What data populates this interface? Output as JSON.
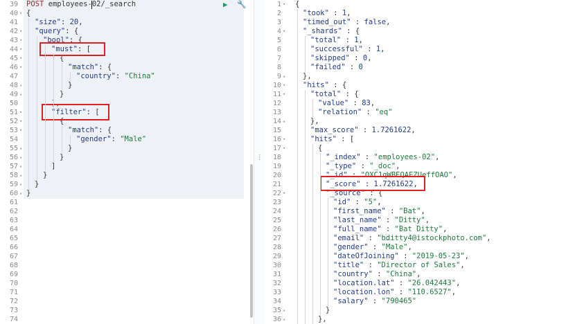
{
  "left_editor": {
    "method": "POST",
    "path_before_cursor": "employees-02",
    "path_after_cursor": "/_search",
    "lines": [
      {
        "n": "39",
        "fold": "",
        "indent": 0,
        "parts": []
      },
      {
        "n": "40",
        "fold": "▾",
        "indent": 0,
        "parts": [
          [
            "pl",
            "{"
          ]
        ]
      },
      {
        "n": "41",
        "fold": "",
        "indent": 1,
        "parts": [
          [
            "key",
            "\"size\""
          ],
          [
            "pl",
            ": "
          ],
          [
            "num",
            "20"
          ],
          [
            "pl",
            ","
          ]
        ]
      },
      {
        "n": "42",
        "fold": "▾",
        "indent": 1,
        "parts": [
          [
            "key",
            "\"query\""
          ],
          [
            "pl",
            ": {"
          ]
        ]
      },
      {
        "n": "43",
        "fold": "▾",
        "indent": 2,
        "parts": [
          [
            "key",
            "\"bool\""
          ],
          [
            "pl",
            ": {"
          ]
        ]
      },
      {
        "n": "44",
        "fold": "▾",
        "indent": 3,
        "parts": [
          [
            "key",
            "\"must\""
          ],
          [
            "pl",
            ": ["
          ]
        ]
      },
      {
        "n": "45",
        "fold": "▾",
        "indent": 4,
        "parts": [
          [
            "pl",
            "{"
          ]
        ]
      },
      {
        "n": "46",
        "fold": "▾",
        "indent": 5,
        "parts": [
          [
            "key",
            "\"match\""
          ],
          [
            "pl",
            ": {"
          ]
        ]
      },
      {
        "n": "47",
        "fold": "",
        "indent": 6,
        "parts": [
          [
            "key",
            "\"country\""
          ],
          [
            "pl",
            ": "
          ],
          [
            "str",
            "\"China\""
          ]
        ]
      },
      {
        "n": "48",
        "fold": "▴",
        "indent": 5,
        "parts": [
          [
            "pl",
            "}"
          ]
        ]
      },
      {
        "n": "49",
        "fold": "▴",
        "indent": 4,
        "parts": [
          [
            "pl",
            "}"
          ]
        ]
      },
      {
        "n": "50",
        "fold": "",
        "indent": 3,
        "parts": [
          [
            "pl",
            "],"
          ]
        ]
      },
      {
        "n": "51",
        "fold": "▾",
        "indent": 3,
        "parts": [
          [
            "key",
            "\"filter\""
          ],
          [
            "pl",
            ": ["
          ]
        ]
      },
      {
        "n": "52",
        "fold": "▾",
        "indent": 4,
        "parts": [
          [
            "pl",
            "{"
          ]
        ]
      },
      {
        "n": "53",
        "fold": "▾",
        "indent": 5,
        "parts": [
          [
            "key",
            "\"match\""
          ],
          [
            "pl",
            ": {"
          ]
        ]
      },
      {
        "n": "54",
        "fold": "",
        "indent": 6,
        "parts": [
          [
            "key",
            "\"gender\""
          ],
          [
            "pl",
            ": "
          ],
          [
            "str",
            "\"Male\""
          ]
        ]
      },
      {
        "n": "55",
        "fold": "▴",
        "indent": 5,
        "parts": [
          [
            "pl",
            "}"
          ]
        ]
      },
      {
        "n": "56",
        "fold": "▴",
        "indent": 4,
        "parts": [
          [
            "pl",
            "}"
          ]
        ]
      },
      {
        "n": "57",
        "fold": "▴",
        "indent": 3,
        "parts": [
          [
            "pl",
            "]"
          ]
        ]
      },
      {
        "n": "58",
        "fold": "▴",
        "indent": 2,
        "parts": [
          [
            "pl",
            "}"
          ]
        ]
      },
      {
        "n": "59",
        "fold": "▴",
        "indent": 1,
        "parts": [
          [
            "pl",
            "}"
          ]
        ]
      },
      {
        "n": "60",
        "fold": "▴",
        "indent": 0,
        "parts": [
          [
            "pl",
            "}"
          ]
        ]
      },
      {
        "n": "61",
        "fold": "",
        "indent": 0,
        "parts": []
      },
      {
        "n": "62",
        "fold": "",
        "indent": 0,
        "parts": []
      },
      {
        "n": "63",
        "fold": "",
        "indent": 0,
        "parts": []
      },
      {
        "n": "64",
        "fold": "",
        "indent": 0,
        "parts": []
      },
      {
        "n": "65",
        "fold": "",
        "indent": 0,
        "parts": []
      },
      {
        "n": "66",
        "fold": "",
        "indent": 0,
        "parts": []
      },
      {
        "n": "67",
        "fold": "",
        "indent": 0,
        "parts": []
      },
      {
        "n": "68",
        "fold": "",
        "indent": 0,
        "parts": []
      },
      {
        "n": "69",
        "fold": "",
        "indent": 0,
        "parts": []
      },
      {
        "n": "70",
        "fold": "",
        "indent": 0,
        "parts": []
      },
      {
        "n": "71",
        "fold": "",
        "indent": 0,
        "parts": []
      },
      {
        "n": "72",
        "fold": "",
        "indent": 0,
        "parts": []
      },
      {
        "n": "73",
        "fold": "",
        "indent": 0,
        "parts": []
      },
      {
        "n": "74",
        "fold": "",
        "indent": 0,
        "parts": []
      }
    ]
  },
  "right_output": {
    "lines": [
      {
        "n": "1",
        "fold": "▾",
        "indent": 0,
        "parts": [
          [
            "pl",
            "{"
          ]
        ]
      },
      {
        "n": "2",
        "fold": "",
        "indent": 1,
        "parts": [
          [
            "key",
            "\"took\""
          ],
          [
            "pl",
            " : "
          ],
          [
            "num",
            "1"
          ],
          [
            "pl",
            ","
          ]
        ]
      },
      {
        "n": "3",
        "fold": "",
        "indent": 1,
        "parts": [
          [
            "key",
            "\"timed_out\""
          ],
          [
            "pl",
            " : "
          ],
          [
            "num",
            "false"
          ],
          [
            "pl",
            ","
          ]
        ]
      },
      {
        "n": "4",
        "fold": "▾",
        "indent": 1,
        "parts": [
          [
            "key",
            "\"_shards\""
          ],
          [
            "pl",
            " : {"
          ]
        ]
      },
      {
        "n": "5",
        "fold": "",
        "indent": 2,
        "parts": [
          [
            "key",
            "\"total\""
          ],
          [
            "pl",
            " : "
          ],
          [
            "num",
            "1"
          ],
          [
            "pl",
            ","
          ]
        ]
      },
      {
        "n": "6",
        "fold": "",
        "indent": 2,
        "parts": [
          [
            "key",
            "\"successful\""
          ],
          [
            "pl",
            " : "
          ],
          [
            "num",
            "1"
          ],
          [
            "pl",
            ","
          ]
        ]
      },
      {
        "n": "7",
        "fold": "",
        "indent": 2,
        "parts": [
          [
            "key",
            "\"skipped\""
          ],
          [
            "pl",
            " : "
          ],
          [
            "num",
            "0"
          ],
          [
            "pl",
            ","
          ]
        ]
      },
      {
        "n": "8",
        "fold": "",
        "indent": 2,
        "parts": [
          [
            "key",
            "\"failed\""
          ],
          [
            "pl",
            " : "
          ],
          [
            "num",
            "0"
          ]
        ]
      },
      {
        "n": "9",
        "fold": "▴",
        "indent": 1,
        "parts": [
          [
            "pl",
            "},"
          ]
        ]
      },
      {
        "n": "10",
        "fold": "▾",
        "indent": 1,
        "parts": [
          [
            "key",
            "\"hits\""
          ],
          [
            "pl",
            " : {"
          ]
        ]
      },
      {
        "n": "11",
        "fold": "▾",
        "indent": 2,
        "parts": [
          [
            "key",
            "\"total\""
          ],
          [
            "pl",
            " : {"
          ]
        ]
      },
      {
        "n": "12",
        "fold": "",
        "indent": 3,
        "parts": [
          [
            "key",
            "\"value\""
          ],
          [
            "pl",
            " : "
          ],
          [
            "num",
            "83"
          ],
          [
            "pl",
            ","
          ]
        ]
      },
      {
        "n": "13",
        "fold": "",
        "indent": 3,
        "parts": [
          [
            "key",
            "\"relation\""
          ],
          [
            "pl",
            " : "
          ],
          [
            "str",
            "\"eq\""
          ]
        ]
      },
      {
        "n": "14",
        "fold": "▴",
        "indent": 2,
        "parts": [
          [
            "pl",
            "},"
          ]
        ]
      },
      {
        "n": "15",
        "fold": "",
        "indent": 2,
        "parts": [
          [
            "key",
            "\"max_score\""
          ],
          [
            "pl",
            " : "
          ],
          [
            "num",
            "1.7261622"
          ],
          [
            "pl",
            ","
          ]
        ]
      },
      {
        "n": "16",
        "fold": "▾",
        "indent": 2,
        "parts": [
          [
            "key",
            "\"hits\""
          ],
          [
            "pl",
            " : ["
          ]
        ]
      },
      {
        "n": "17",
        "fold": "▾",
        "indent": 3,
        "parts": [
          [
            "pl",
            "{"
          ]
        ]
      },
      {
        "n": "18",
        "fold": "",
        "indent": 4,
        "parts": [
          [
            "key",
            "\"_index\""
          ],
          [
            "pl",
            " : "
          ],
          [
            "str",
            "\"employees-02\""
          ],
          [
            "pl",
            ","
          ]
        ]
      },
      {
        "n": "19",
        "fold": "",
        "indent": 4,
        "parts": [
          [
            "key",
            "\"_type\""
          ],
          [
            "pl",
            " : "
          ],
          [
            "str",
            "\"_doc\""
          ],
          [
            "pl",
            ","
          ]
        ]
      },
      {
        "n": "20",
        "fold": "",
        "indent": 4,
        "parts": [
          [
            "key",
            "\"_id\""
          ],
          [
            "pl",
            " : "
          ],
          [
            "str",
            "\"OXC1qWBEQAEZUeffOAO\""
          ],
          [
            "pl",
            ","
          ]
        ]
      },
      {
        "n": "21",
        "fold": "",
        "indent": 4,
        "parts": [
          [
            "key",
            "\"_score\""
          ],
          [
            "pl",
            " : "
          ],
          [
            "num",
            "1.7261622"
          ],
          [
            "pl",
            ","
          ]
        ]
      },
      {
        "n": "22",
        "fold": "▾",
        "indent": 4,
        "parts": [
          [
            "key",
            "\"_source\""
          ],
          [
            "pl",
            " : {"
          ]
        ]
      },
      {
        "n": "23",
        "fold": "",
        "indent": 5,
        "parts": [
          [
            "key",
            "\"id\""
          ],
          [
            "pl",
            " : "
          ],
          [
            "str",
            "\"5\""
          ],
          [
            "pl",
            ","
          ]
        ]
      },
      {
        "n": "24",
        "fold": "",
        "indent": 5,
        "parts": [
          [
            "key",
            "\"first_name\""
          ],
          [
            "pl",
            " : "
          ],
          [
            "str",
            "\"Bat\""
          ],
          [
            "pl",
            ","
          ]
        ]
      },
      {
        "n": "25",
        "fold": "",
        "indent": 5,
        "parts": [
          [
            "key",
            "\"last_name\""
          ],
          [
            "pl",
            " : "
          ],
          [
            "str",
            "\"Ditty\""
          ],
          [
            "pl",
            ","
          ]
        ]
      },
      {
        "n": "26",
        "fold": "",
        "indent": 5,
        "parts": [
          [
            "key",
            "\"full_name\""
          ],
          [
            "pl",
            " : "
          ],
          [
            "str",
            "\"Bat Ditty\""
          ],
          [
            "pl",
            ","
          ]
        ]
      },
      {
        "n": "27",
        "fold": "",
        "indent": 5,
        "parts": [
          [
            "key",
            "\"email\""
          ],
          [
            "pl",
            " : "
          ],
          [
            "str",
            "\"bditty4@istockphoto.com\""
          ],
          [
            "pl",
            ","
          ]
        ]
      },
      {
        "n": "28",
        "fold": "",
        "indent": 5,
        "parts": [
          [
            "key",
            "\"gender\""
          ],
          [
            "pl",
            " : "
          ],
          [
            "str",
            "\"Male\""
          ],
          [
            "pl",
            ","
          ]
        ]
      },
      {
        "n": "29",
        "fold": "",
        "indent": 5,
        "parts": [
          [
            "key",
            "\"dateOfJoining\""
          ],
          [
            "pl",
            " : "
          ],
          [
            "str",
            "\"2019-05-23\""
          ],
          [
            "pl",
            ","
          ]
        ]
      },
      {
        "n": "30",
        "fold": "",
        "indent": 5,
        "parts": [
          [
            "key",
            "\"title\""
          ],
          [
            "pl",
            " : "
          ],
          [
            "str",
            "\"Director of Sales\""
          ],
          [
            "pl",
            ","
          ]
        ]
      },
      {
        "n": "31",
        "fold": "",
        "indent": 5,
        "parts": [
          [
            "key",
            "\"country\""
          ],
          [
            "pl",
            " : "
          ],
          [
            "str",
            "\"China\""
          ],
          [
            "pl",
            ","
          ]
        ]
      },
      {
        "n": "32",
        "fold": "",
        "indent": 5,
        "parts": [
          [
            "key",
            "\"location.lat\""
          ],
          [
            "pl",
            " : "
          ],
          [
            "str",
            "\"26.042443\""
          ],
          [
            "pl",
            ","
          ]
        ]
      },
      {
        "n": "33",
        "fold": "",
        "indent": 5,
        "parts": [
          [
            "key",
            "\"location.lon\""
          ],
          [
            "pl",
            " : "
          ],
          [
            "str",
            "\"110.6527\""
          ],
          [
            "pl",
            ","
          ]
        ]
      },
      {
        "n": "34",
        "fold": "",
        "indent": 5,
        "parts": [
          [
            "key",
            "\"salary\""
          ],
          [
            "pl",
            " : "
          ],
          [
            "str",
            "\"790465\""
          ]
        ]
      },
      {
        "n": "35",
        "fold": "▴",
        "indent": 4,
        "parts": [
          [
            "pl",
            "}"
          ]
        ]
      },
      {
        "n": "36",
        "fold": "▴",
        "indent": 3,
        "parts": [
          [
            "pl",
            "},"
          ]
        ]
      }
    ]
  },
  "icons": {
    "run": "play-icon",
    "settings": "wrench-icon"
  },
  "colors": {
    "highlight_box": "#e02020",
    "key": "#223c8a",
    "string": "#1d7a3b",
    "method": "#b0232a"
  }
}
